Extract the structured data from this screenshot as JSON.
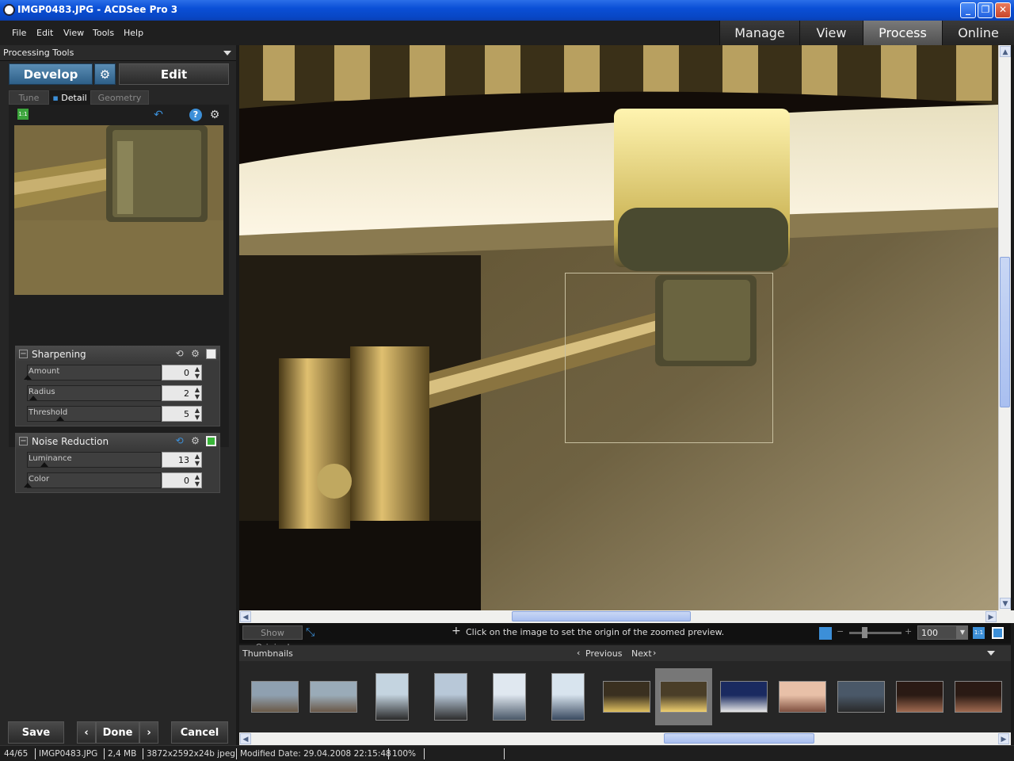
{
  "window": {
    "title": "IMGP0483.JPG - ACDSee Pro 3"
  },
  "menu": [
    "File",
    "Edit",
    "View",
    "Tools",
    "Help"
  ],
  "modes": [
    {
      "label": "Manage",
      "active": false
    },
    {
      "label": "View",
      "active": false
    },
    {
      "label": "Process",
      "active": true
    },
    {
      "label": "Online",
      "active": false
    }
  ],
  "left_panel": {
    "header": "Processing Tools",
    "develop_label": "Develop",
    "edit_label": "Edit",
    "subtabs": [
      {
        "label": "Tune",
        "active": false
      },
      {
        "label": "Detail",
        "active": true
      },
      {
        "label": "Geometry",
        "active": false
      }
    ],
    "zoom_badge": "1:1",
    "sharpening": {
      "title": "Sharpening",
      "enabled": false,
      "sliders": [
        {
          "label": "Amount",
          "value": "0",
          "level": 0.0
        },
        {
          "label": "Radius",
          "value": "2",
          "level": 0.04
        },
        {
          "label": "Threshold",
          "value": "5",
          "level": 0.25
        }
      ]
    },
    "noise_reduction": {
      "title": "Noise Reduction",
      "enabled": true,
      "sliders": [
        {
          "label": "Luminance",
          "value": "13",
          "level": 0.13
        },
        {
          "label": "Color",
          "value": "0",
          "level": 0.0
        }
      ]
    },
    "buttons": {
      "save": "Save",
      "done": "Done",
      "cancel": "Cancel"
    }
  },
  "info_bar": {
    "show_original": "Show Original",
    "message": "Click on the image to set the origin of the zoomed preview.",
    "zoom": "100"
  },
  "thumbnails": {
    "title": "Thumbnails",
    "previous": "Previous",
    "next": "Next",
    "selected_index": 7,
    "items": [
      {
        "name": "thumb-1",
        "colors": [
          "#8fa0b0",
          "#6b5a48"
        ]
      },
      {
        "name": "thumb-2",
        "colors": [
          "#9aabb8",
          "#6a5848"
        ]
      },
      {
        "name": "thumb-3",
        "colors": [
          "#c4d4e0",
          "#2a2a2a"
        ]
      },
      {
        "name": "thumb-4",
        "colors": [
          "#b8c8d8",
          "#2d2d2d"
        ]
      },
      {
        "name": "thumb-5",
        "colors": [
          "#e0e8f0",
          "#4a5868"
        ]
      },
      {
        "name": "thumb-6",
        "colors": [
          "#d8e4ee",
          "#3a4a60"
        ]
      },
      {
        "name": "thumb-7",
        "colors": [
          "#3a3020",
          "#e0c060"
        ]
      },
      {
        "name": "thumb-8",
        "colors": [
          "#4a3e28",
          "#f0d070"
        ]
      },
      {
        "name": "thumb-9",
        "colors": [
          "#1a2a60",
          "#e8e8e8"
        ]
      },
      {
        "name": "thumb-10",
        "colors": [
          "#e8c0a8",
          "#805040"
        ]
      },
      {
        "name": "thumb-11",
        "colors": [
          "#4a5868",
          "#2a2a2a"
        ]
      },
      {
        "name": "thumb-12",
        "colors": [
          "#2a1a14",
          "#a06a50"
        ]
      },
      {
        "name": "thumb-13",
        "colors": [
          "#2a1a14",
          "#a06a50"
        ]
      }
    ]
  },
  "status": {
    "position": "44/65",
    "filename": "IMGP0483.JPG",
    "size": "2,4 MB",
    "dims": "3872x2592x24b jpeg",
    "modified": "Modified Date: 29.04.2008 22:15:48",
    "zoom": "100%"
  }
}
